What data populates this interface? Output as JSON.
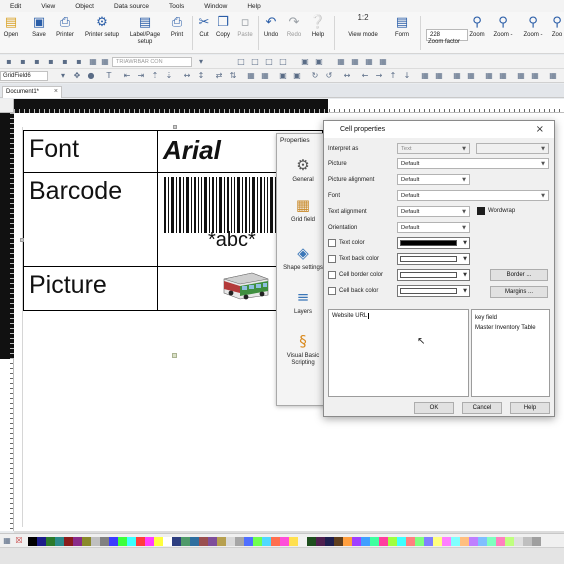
{
  "menubar": [
    "Edit",
    "View",
    "Object",
    "Data source",
    "Tools",
    "Window",
    "Help"
  ],
  "ribbon": {
    "open": "Open",
    "save": "Save",
    "printer": "Printer",
    "printer_setup": "Printer setup",
    "label_page_setup": "Label/Page setup",
    "print": "Print",
    "cut": "Cut",
    "copy": "Copy",
    "paste": "Paste",
    "undo": "Undo",
    "redo": "Redo",
    "help": "Help",
    "view_mode_value": "1:2",
    "view_mode": "View mode",
    "form": "Form",
    "zoom_factor_value": "228",
    "zoom_factor": "Zoom factor",
    "zoom": "Zoom",
    "zoom_minus": "Zoom -",
    "zoom_minus2": "Zoom -",
    "zoom_last": "Zoo"
  },
  "toolbar2": {
    "field_combo": "GridField6",
    "font_combo": "TRIAWRBAR CON"
  },
  "document_tab": "Document1*",
  "label": {
    "row1_left": "Font",
    "row1_right": "Arial",
    "row2_left": "Barcode",
    "barcode_value": "*abc*",
    "row3_left": "Picture"
  },
  "properties_panel": {
    "title": "Properties",
    "items": [
      "General",
      "Grid field",
      "Shape settings",
      "Layers",
      "Visual Basic Scripting"
    ]
  },
  "dialog": {
    "title": "Cell properties",
    "interpret_as_label": "Interpret as",
    "interpret_as_value": "Text",
    "picture_label": "Picture",
    "picture_value": "Default",
    "picture_alignment_label": "Picture alignment",
    "picture_alignment_value": "Default",
    "font_label": "Font",
    "font_value": "Default",
    "text_alignment_label": "Text alignment",
    "text_alignment_value": "Default",
    "wordwrap_label": "Wordwrap",
    "orientation_label": "Orientation",
    "orientation_value": "Default",
    "text_color_label": "Text color",
    "text_back_color_label": "Text back color",
    "cell_border_color_label": "Cell border color",
    "cell_back_color_label": "Cell back color",
    "border_button": "Border ...",
    "margins_button": "Margins ...",
    "text_content": "Website URL",
    "key_list": [
      "key field",
      "Master Inventory Table"
    ],
    "ok_button": "OK",
    "cancel_button": "Cancel",
    "help_button": "Help"
  },
  "colors": {
    "accent": "#2b5ea8",
    "text_color": "#000000",
    "palette": [
      "#000000",
      "#1c1c8a",
      "#2b7a2b",
      "#2b8a8a",
      "#8a1c1c",
      "#8a2b8a",
      "#8a8a2b",
      "#c0c0c0",
      "#808080",
      "#3c3cff",
      "#3cff3c",
      "#3cffff",
      "#ff3c3c",
      "#ff3cff",
      "#ffff3c",
      "#ffffff",
      "#2e3f80",
      "#4f9a6a",
      "#2f6f9f",
      "#9a4f4f",
      "#7f4f9a",
      "#b7a04f",
      "#d9d9d9",
      "#a6a6a6",
      "#4f6fff",
      "#6fff4f",
      "#4fd9ff",
      "#ff6f4f",
      "#ff4fd9",
      "#ffe04f",
      "#f2f2f2",
      "#1f4f1f",
      "#4f1f4f",
      "#1f1f4f",
      "#5f3f1f",
      "#ff9f3f",
      "#9f3fff",
      "#3f9fff",
      "#3fff9f",
      "#ff3f9f",
      "#9fff3f",
      "#3fffff",
      "#ff7f7f",
      "#7fff7f",
      "#7f7fff",
      "#ffff7f",
      "#ff7fff",
      "#7fffff",
      "#ffbf7f",
      "#bf7fff",
      "#7fbfff",
      "#7fffbf",
      "#ff7fbf",
      "#bfff7f",
      "#dfdfdf",
      "#bfbfbf",
      "#9f9f9f"
    ]
  }
}
